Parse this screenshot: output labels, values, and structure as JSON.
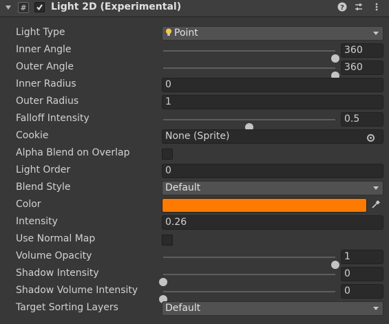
{
  "component": {
    "title": "Light 2D (Experimental)",
    "script_glyph": "#"
  },
  "properties": {
    "light_type": {
      "label": "Light Type",
      "value": "Point"
    },
    "inner_angle": {
      "label": "Inner Angle",
      "value": "360",
      "fraction": 1.0
    },
    "outer_angle": {
      "label": "Outer Angle",
      "value": "360",
      "fraction": 1.0
    },
    "inner_radius": {
      "label": "Inner Radius",
      "value": "0"
    },
    "outer_radius": {
      "label": "Outer Radius",
      "value": "1"
    },
    "falloff_intensity": {
      "label": "Falloff Intensity",
      "value": "0.5",
      "fraction": 0.5
    },
    "cookie": {
      "label": "Cookie",
      "value": "None (Sprite)"
    },
    "alpha_blend": {
      "label": "Alpha Blend on Overlap",
      "checked": false
    },
    "light_order": {
      "label": "Light Order",
      "value": "0"
    },
    "blend_style": {
      "label": "Blend Style",
      "value": "Default"
    },
    "color": {
      "label": "Color",
      "swatch": "#ff7a00"
    },
    "intensity": {
      "label": "Intensity",
      "value": "0.26"
    },
    "use_normal_map": {
      "label": "Use Normal Map",
      "checked": false
    },
    "volume_opacity": {
      "label": "Volume Opacity",
      "value": "1",
      "fraction": 1.0
    },
    "shadow_intensity": {
      "label": "Shadow Intensity",
      "value": "0",
      "fraction": 0.0
    },
    "shadow_volume_intensity": {
      "label": "Shadow Volume Intensity",
      "value": "0",
      "fraction": 0.0
    },
    "target_sorting_layers": {
      "label": "Target Sorting Layers",
      "value": "Default"
    }
  },
  "icons": [
    "foldout-arrow-icon",
    "script-icon",
    "enabled-checkbox",
    "help-icon",
    "preset-icon",
    "context-menu-icon",
    "bulb-icon",
    "object-picker-icon",
    "eyedropper-icon",
    "dropdown-arrow-icon"
  ]
}
